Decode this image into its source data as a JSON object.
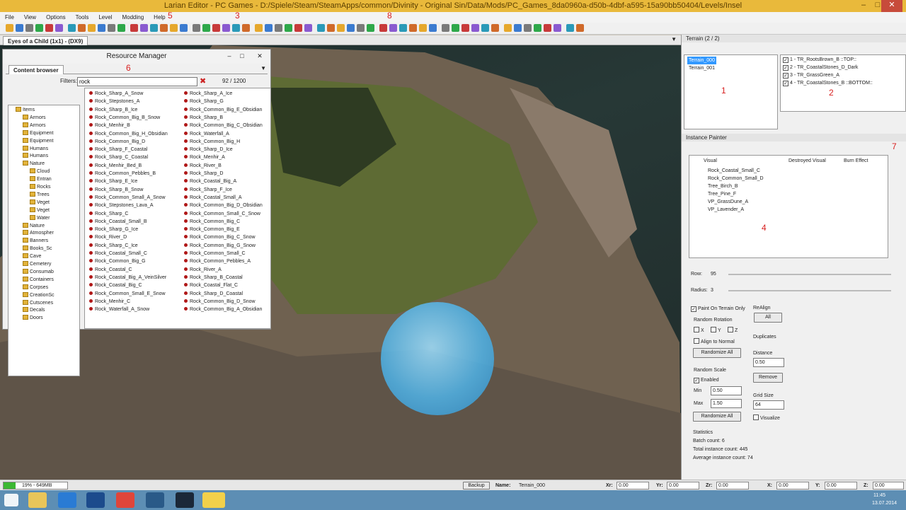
{
  "window": {
    "title": "Larian Editor - PC Games - D:/Spiele/Steam/SteamApps/common/Divinity - Original Sin/Data/Mods/PC_Games_8da0960a-d50b-4dbf-a595-15a90bb50404/Levels/Insel"
  },
  "menu": [
    "File",
    "View",
    "Options",
    "Tools",
    "Level",
    "Modding",
    "Help"
  ],
  "annotations": {
    "n1": "1",
    "n2": "2",
    "n3": "3",
    "n4": "4",
    "n5": "5",
    "n6": "6",
    "n7": "7",
    "n8": "8"
  },
  "viewport": {
    "tab": "Eyes of a Child (1x1) - (DX9)"
  },
  "resource_manager": {
    "title": "Resource Manager",
    "tab": "Content browser",
    "filter_label": "Filters:",
    "filter_value": "rock",
    "count": "92 / 1200",
    "tree": [
      {
        "label": "Items",
        "indent": 1
      },
      {
        "label": "Armors",
        "indent": 2
      },
      {
        "label": "Armors",
        "indent": 2
      },
      {
        "label": "Equipment",
        "indent": 2
      },
      {
        "label": "Equipment",
        "indent": 2
      },
      {
        "label": "Humans",
        "indent": 2
      },
      {
        "label": "Humans",
        "indent": 2
      },
      {
        "label": "Nature",
        "indent": 2
      },
      {
        "label": "Cloud",
        "indent": 3
      },
      {
        "label": "Entran",
        "indent": 3
      },
      {
        "label": "Rocks",
        "indent": 3
      },
      {
        "label": "Trees",
        "indent": 3
      },
      {
        "label": "Veget",
        "indent": 3
      },
      {
        "label": "Veget",
        "indent": 3
      },
      {
        "label": "Water",
        "indent": 3
      },
      {
        "label": "Nature",
        "indent": 2
      },
      {
        "label": "Atmospher",
        "indent": 2
      },
      {
        "label": "Banners",
        "indent": 2
      },
      {
        "label": "Books_Sc",
        "indent": 2
      },
      {
        "label": "Cave",
        "indent": 2
      },
      {
        "label": "Cemetery",
        "indent": 2
      },
      {
        "label": "Consumab",
        "indent": 2
      },
      {
        "label": "Containers",
        "indent": 2
      },
      {
        "label": "Corpses",
        "indent": 2
      },
      {
        "label": "CreationSc",
        "indent": 2
      },
      {
        "label": "Cutscenes",
        "indent": 2
      },
      {
        "label": "Decals",
        "indent": 2
      },
      {
        "label": "Doors",
        "indent": 2
      }
    ],
    "col1": [
      "Rock_Sharp_A_Snow",
      "Rock_Stepstones_A",
      "Rock_Sharp_B_Ice",
      "Rock_Common_Big_B_Snow",
      "Rock_Menhir_B",
      "Rock_Common_Big_H_Obsidian",
      "Rock_Common_Big_D",
      "Rock_Sharp_F_Coastal",
      "Rock_Sharp_C_Coastal",
      "Rock_Menhir_Bed_B",
      "Rock_Common_Pebbles_B",
      "Rock_Sharp_E_Ice",
      "Rock_Sharp_B_Snow",
      "Rock_Common_Small_A_Snow",
      "Rock_Stepstones_Lava_A",
      "Rock_Sharp_C",
      "Rock_Coastal_Small_B",
      "Rock_Sharp_G_Ice",
      "Rock_River_D",
      "Rock_Sharp_C_Ice",
      "Rock_Coastal_Small_C",
      "Rock_Common_Big_G",
      "Rock_Coastal_C",
      "Rock_Coastal_Big_A_VeinSilver",
      "Rock_Coastal_Big_C",
      "Rock_Common_Small_E_Snow",
      "Rock_Menhir_C",
      "Rock_Waterfall_A_Snow"
    ],
    "col2": [
      "Rock_Sharp_A_Ice",
      "Rock_Sharp_G",
      "Rock_Common_Big_E_Obsidian",
      "Rock_Sharp_B",
      "Rock_Common_Big_C_Obsidian",
      "Rock_Waterfall_A",
      "Rock_Common_Big_H",
      "Rock_Sharp_D_Ice",
      "Rock_Menhir_A",
      "Rock_River_B",
      "Rock_Sharp_D",
      "Rock_Coastal_Big_A",
      "Rock_Sharp_F_Ice",
      "Rock_Coastal_Small_A",
      "Rock_Common_Big_D_Obsidian",
      "Rock_Common_Small_C_Snow",
      "Rock_Common_Big_C",
      "Rock_Common_Big_E",
      "Rock_Common_Big_C_Snow",
      "Rock_Common_Big_G_Snow",
      "Rock_Common_Small_C",
      "Rock_Common_Pebbles_A",
      "Rock_River_A",
      "Rock_Sharp_B_Coastal",
      "Rock_Coastal_Flat_C",
      "Rock_Sharp_D_Coastal",
      "Rock_Common_Big_D_Snow",
      "Rock_Common_Big_A_Obsidian"
    ]
  },
  "terrain": {
    "title": "Terrain (2 / 2)",
    "items": [
      "Terrain_000",
      "Terrain_001"
    ],
    "layers": [
      "1 - TR_RootsBrown_B ::TOP::",
      "2 - TR_CoastalStones_D_Dark",
      "3 - TR_GrassGreen_A",
      "4 - TR_CoastalStones_B ::BOTTOM::"
    ]
  },
  "instance_painter": {
    "title": "Instance Painter",
    "columns": [
      "Visual",
      "Destroyed Visual",
      "Burn Effect"
    ],
    "rows": [
      "Rock_Coastal_Small_C",
      "Rock_Common_Small_D",
      "Tree_Birch_B",
      "Tree_Pine_F",
      "VP_GrassDune_A",
      "VP_Lavender_A"
    ],
    "row_label": "Row:",
    "row_value": "95",
    "radius_label": "Radius:",
    "radius_value": "3",
    "paint_on_terrain": "Paint On Terrain Only",
    "realign": "ReAlign",
    "all": "All",
    "random_rotation": "Random Rotation",
    "x": "X",
    "y": "Y",
    "z": "Z",
    "align_normal": "Align to Normal",
    "randomize_all": "Randomize All",
    "duplicates": "Duplicates",
    "distance": "Distance",
    "distance_value": "0.50",
    "remove": "Remove",
    "random_scale": "Random Scale",
    "enabled": "Enabled",
    "min": "Min",
    "min_value": "0.50",
    "max": "Max",
    "max_value": "1.50",
    "grid_size": "Grid Size",
    "grid_value": "64",
    "visualize": "Visualize",
    "statistics": "Statistics",
    "batch": "Batch count:  6",
    "total": "Total instance count:  445",
    "average": "Average instance count:  74"
  },
  "status": {
    "memory": "19% - 649MB",
    "backup": "Backup",
    "name_label": "Name:",
    "name_value": "Terrain_000",
    "xr": "Xr:",
    "xr_v": "0.00",
    "yr": "Yr:",
    "yr_v": "0.00",
    "zr": "Zr:",
    "zr_v": "0.00",
    "x": "X:",
    "x_v": "0.00",
    "y": "Y:",
    "y_v": "0.00",
    "z": "Z:",
    "z_v": "0.00"
  },
  "taskbar": {
    "time": "11:45",
    "date": "13.07.2014"
  }
}
